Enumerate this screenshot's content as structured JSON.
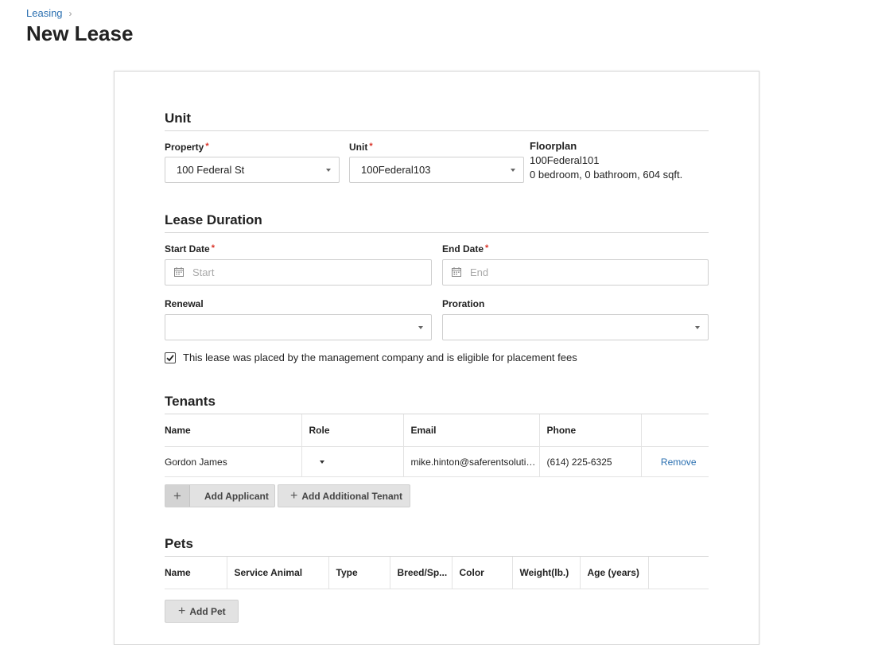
{
  "breadcrumb": {
    "parent": "Leasing",
    "separator": "›"
  },
  "page": {
    "title": "New Lease"
  },
  "unit_section": {
    "title": "Unit",
    "property_label": "Property",
    "property_value": "100 Federal St",
    "unit_label": "Unit",
    "unit_value": "100Federal103",
    "floorplan_label": "Floorplan",
    "floorplan_name": "100Federal101",
    "floorplan_details": "0 bedroom, 0 bathroom, 604 sqft."
  },
  "lease_duration": {
    "title": "Lease Duration",
    "start_label": "Start Date",
    "start_placeholder": "Start",
    "end_label": "End Date",
    "end_placeholder": "End",
    "renewal_label": "Renewal",
    "renewal_value": "",
    "proration_label": "Proration",
    "proration_value": "",
    "placement_checkbox_label": "This lease was placed by the management company and is eligible for placement fees",
    "placement_checked": true
  },
  "tenants": {
    "title": "Tenants",
    "columns": [
      "Name",
      "Role",
      "Email",
      "Phone"
    ],
    "rows": [
      {
        "name": "Gordon James",
        "role": "",
        "email": "mike.hinton@saferentsolutio...",
        "phone": "(614) 225-6325",
        "action": "Remove"
      }
    ],
    "add_applicant_label": "Add Applicant",
    "add_additional_tenant_label": "Add Additional Tenant"
  },
  "pets": {
    "title": "Pets",
    "columns": [
      "Name",
      "Service Animal",
      "Type",
      "Breed/Sp...",
      "Color",
      "Weight(lb.)",
      "Age (years)"
    ],
    "add_pet_label": "Add Pet"
  },
  "required_marker": "*",
  "icons": {
    "breadcrumb_chevron": "chevron-right-icon",
    "select_caret": "caret-down-icon",
    "date": "calendar-icon",
    "add": "plus-icon",
    "checkbox": "checkmark-icon"
  },
  "colors": {
    "link": "#2a6fb0",
    "required": "#d93025",
    "button_bg": "#e2e2e2"
  }
}
